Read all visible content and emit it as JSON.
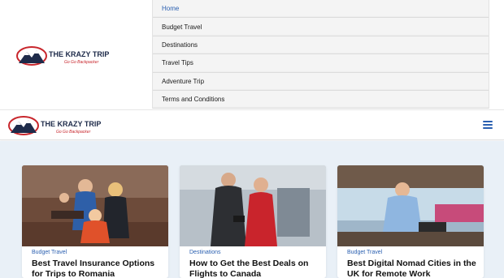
{
  "brand": {
    "name": "THE KRAZY TRIP",
    "tagline": "Go Go Backpacker",
    "colors": {
      "red": "#c8262c",
      "navy": "#1e2b4a"
    }
  },
  "nav": {
    "items": [
      {
        "label": "Home",
        "active": true
      },
      {
        "label": "Budget Travel",
        "active": false
      },
      {
        "label": "Destinations",
        "active": false
      },
      {
        "label": "Travel Tips",
        "active": false
      },
      {
        "label": "Adventure Trip",
        "active": false
      },
      {
        "label": "Terms and Conditions",
        "active": false
      }
    ]
  },
  "header": {
    "menu_icon": "hamburger-menu-icon",
    "accent": "#2a5fb0"
  },
  "posts": [
    {
      "category": "Budget Travel",
      "title": "Best Travel Insurance Options for Trips to Romania"
    },
    {
      "category": "Destinations",
      "title": "How to Get the Best Deals on Flights to Canada"
    },
    {
      "category": "Budget Travel",
      "title": "Best Digital Nomad Cities in the UK for Remote Work"
    }
  ]
}
